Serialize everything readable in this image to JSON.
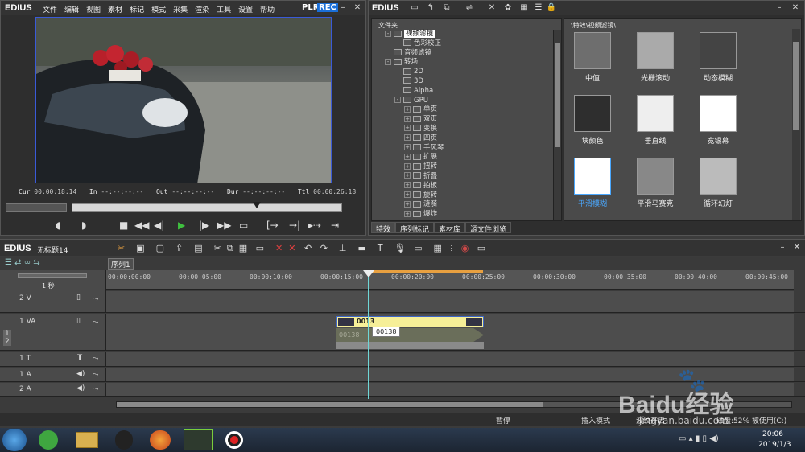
{
  "player": {
    "logo": "EDIUS",
    "menu": [
      "文件",
      "编辑",
      "视图",
      "素材",
      "标记",
      "模式",
      "采集",
      "渲染",
      "工具",
      "设置",
      "帮助"
    ],
    "plr": "PLR",
    "rec": "REC",
    "cur_label": "Cur",
    "cur_value": "00:00:18:14",
    "in_label": "In",
    "in_value": "--:--:--:--",
    "out_label": "Out",
    "out_value": "--:--:--:--",
    "dur_label": "Dur",
    "dur_value": "--:--:--:--",
    "ttl_label": "Ttl",
    "ttl_value": "00:00:26:18"
  },
  "effects": {
    "logo": "EDIUS",
    "folder_header": "文件夹",
    "path_header": "\\特效\\视频滤镜\\",
    "tree": [
      {
        "label": "视频滤镜",
        "level": 1,
        "selected": true,
        "folder": true,
        "toggle": "-"
      },
      {
        "label": "色彩校正",
        "level": 2,
        "folder": true,
        "toggle": ""
      },
      {
        "label": "音频滤镜",
        "level": 1,
        "folder": true,
        "toggle": ""
      },
      {
        "label": "转场",
        "level": 1,
        "folder": true,
        "toggle": "-"
      },
      {
        "label": "2D",
        "level": 2,
        "folder": false,
        "toggle": ""
      },
      {
        "label": "3D",
        "level": 2,
        "folder": false,
        "toggle": ""
      },
      {
        "label": "Alpha",
        "level": 2,
        "folder": false,
        "toggle": ""
      },
      {
        "label": "GPU",
        "level": 2,
        "folder": false,
        "toggle": "-"
      },
      {
        "label": "单页",
        "level": 3,
        "folder": false,
        "toggle": "+"
      },
      {
        "label": "双页",
        "level": 3,
        "folder": false,
        "toggle": "+"
      },
      {
        "label": "变换",
        "level": 3,
        "folder": false,
        "toggle": "+"
      },
      {
        "label": "四页",
        "level": 3,
        "folder": false,
        "toggle": "+"
      },
      {
        "label": "手风琴",
        "level": 3,
        "folder": false,
        "toggle": "+"
      },
      {
        "label": "扩展",
        "level": 3,
        "folder": false,
        "toggle": "+"
      },
      {
        "label": "扭转",
        "level": 3,
        "folder": false,
        "toggle": "+"
      },
      {
        "label": "折叠",
        "level": 3,
        "folder": false,
        "toggle": "+"
      },
      {
        "label": "拍板",
        "level": 3,
        "folder": false,
        "toggle": "+"
      },
      {
        "label": "旋转",
        "level": 3,
        "folder": false,
        "toggle": "+"
      },
      {
        "label": "涟漪",
        "level": 3,
        "folder": false,
        "toggle": "+"
      },
      {
        "label": "爆炸",
        "level": 3,
        "folder": false,
        "toggle": "+"
      }
    ],
    "thumbnails": [
      {
        "label": "中值",
        "selected": false
      },
      {
        "label": "光栅滚动",
        "selected": false
      },
      {
        "label": "动态模糊",
        "selected": false
      },
      {
        "label": "块颜色",
        "selected": false
      },
      {
        "label": "垂直线",
        "selected": false
      },
      {
        "label": "宽银幕",
        "selected": false
      },
      {
        "label": "平滑模糊",
        "selected": true
      },
      {
        "label": "平滑马赛克",
        "selected": false
      },
      {
        "label": "循环幻灯",
        "selected": false
      }
    ],
    "tabs": [
      "特效",
      "序列标记",
      "素材库",
      "源文件浏览"
    ]
  },
  "timeline": {
    "logo": "EDIUS",
    "project": "无标题14",
    "sequence_tab": "序列1",
    "zoom_label": "1 秒",
    "ruler": [
      "00:00:00:00",
      "00:00:05:00",
      "00:00:10:00",
      "00:00:15:00",
      "00:00:20:00",
      "00:00:25:00",
      "00:00:30:00",
      "00:00:35:00",
      "00:00:40:00",
      "00:00:45:00"
    ],
    "tracks": [
      "2 V",
      "1 VA",
      "1 T",
      "1 A",
      "2 A"
    ],
    "clip_label": "0013",
    "clip_audio_label": "00138",
    "tooltip": "00138",
    "status": {
      "mode1": "暂停",
      "mode2": "插入模式",
      "mode3": "波纹开启",
      "disk": "磁盘:52% 被使用(C:)"
    }
  },
  "taskbar": {
    "time": "20:06",
    "date": "2019/1/3"
  },
  "watermark": {
    "brand": "Baidu经验",
    "url": "jingyan.baidu.com"
  }
}
